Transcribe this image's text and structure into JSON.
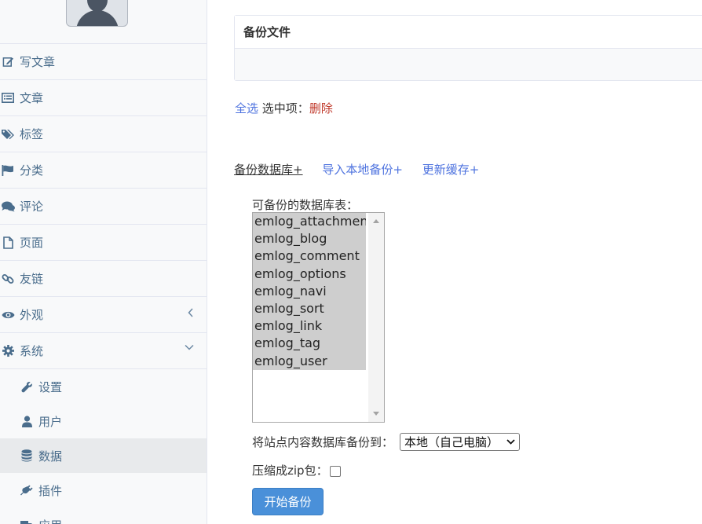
{
  "sidebar": {
    "items": [
      {
        "label": "写文章",
        "icon": "edit-icon"
      },
      {
        "label": "文章",
        "icon": "list-icon"
      },
      {
        "label": "标签",
        "icon": "tags-icon"
      },
      {
        "label": "分类",
        "icon": "flag-icon"
      },
      {
        "label": "评论",
        "icon": "comments-icon"
      },
      {
        "label": "页面",
        "icon": "file-icon"
      },
      {
        "label": "友链",
        "icon": "link-icon"
      },
      {
        "label": "外观",
        "icon": "eye-icon",
        "chevron": "‹"
      },
      {
        "label": "系统",
        "icon": "gear-icon",
        "chevron": "⌄"
      }
    ],
    "subitems": [
      {
        "label": "设置",
        "icon": "wrench-icon"
      },
      {
        "label": "用户",
        "icon": "user-icon"
      },
      {
        "label": "数据",
        "icon": "database-icon",
        "active": true
      },
      {
        "label": "插件",
        "icon": "plug-icon"
      },
      {
        "label": "应用",
        "icon": "truck-icon"
      }
    ]
  },
  "panel": {
    "title": "备份文件"
  },
  "select_actions": {
    "select_all": "全选",
    "selected_label": "选中项：",
    "delete": "删除"
  },
  "tabs": [
    "备份数据库+",
    "导入本地备份+",
    "更新缓存+"
  ],
  "backup": {
    "tables_label": "可备份的数据库表：",
    "tables": [
      "emlog_attachment",
      "emlog_blog",
      "emlog_comment",
      "emlog_options",
      "emlog_navi",
      "emlog_sort",
      "emlog_link",
      "emlog_tag",
      "emlog_user"
    ],
    "dest_label": "将站点内容数据库备份到：",
    "dest_value": "本地（自己电脑）",
    "zip_label": "压缩成zip包：",
    "zip_checked": false,
    "start_button": "开始备份"
  },
  "colors": {
    "link": "#4e73df",
    "danger": "#c0392b",
    "primary_button": "#4a90d9",
    "sidebar_text": "#4a6d8c"
  }
}
